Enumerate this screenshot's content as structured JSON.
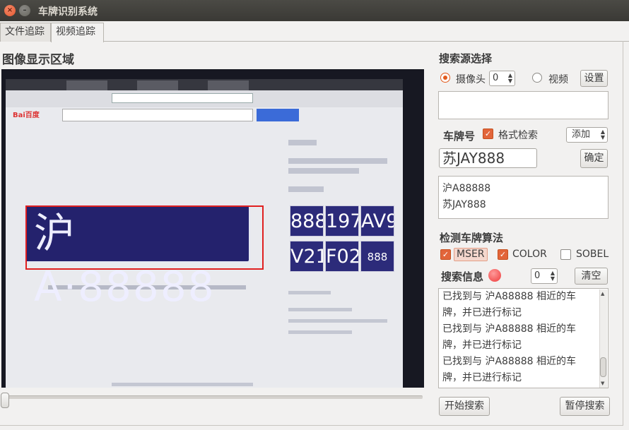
{
  "window": {
    "title": "车牌识别系统"
  },
  "tabs": [
    {
      "label": "文件追踪"
    },
    {
      "label": "视频追踪"
    }
  ],
  "image_area": {
    "title": "图像显示区域",
    "plate_text": "沪A·88888",
    "thumbs": [
      "888",
      "197",
      "AV9",
      "V21",
      "F02",
      "888"
    ]
  },
  "source": {
    "title": "搜索源选择",
    "camera_label": "摄像头",
    "camera_index": "0",
    "video_label": "视频",
    "settings_label": "设置",
    "selected": "camera"
  },
  "plate": {
    "title": "车牌号",
    "format_search_label": "格式检索",
    "format_search_checked": true,
    "add_label": "添加",
    "input_value": "苏JAY888",
    "confirm_label": "确定",
    "list": [
      "沪A88888",
      "苏JAY888"
    ]
  },
  "algorithms": {
    "title": "检测车牌算法",
    "options": [
      {
        "label": "MSER",
        "checked": true
      },
      {
        "label": "COLOR",
        "checked": true
      },
      {
        "label": "SOBEL",
        "checked": false
      }
    ]
  },
  "search_info": {
    "title": "搜索信息",
    "count": "0",
    "clear_label": "清空",
    "lines": [
      "已找到与 沪A88888 相近的车",
      "牌，并已进行标记",
      "已找到与 沪A88888 相近的车",
      "牌，并已进行标记",
      "已找到与 沪A88888 相近的车",
      "牌，并已进行标记"
    ]
  },
  "controls": {
    "start_label": "开始搜索",
    "pause_label": "暂停搜索"
  },
  "colors": {
    "accent": "#e25a1c",
    "title_bar": "#3f3e39",
    "plate_box": "#e02020"
  }
}
